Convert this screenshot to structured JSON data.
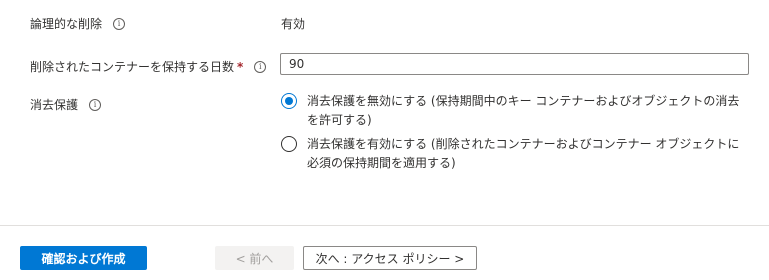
{
  "fields": {
    "soft_delete": {
      "label": "論理的な削除",
      "value": "有効"
    },
    "retention_days": {
      "label": "削除されたコンテナーを保持する日数",
      "required_mark": "*",
      "value": "90"
    },
    "purge_protection": {
      "label": "消去保護",
      "options": [
        {
          "label": "消去保護を無効にする (保持期間中のキー コンテナーおよびオブジェクトの消去を許可する)",
          "checked": true
        },
        {
          "label": "消去保護を有効にする (削除されたコンテナーおよびコンテナー オブジェクトに必須の保持期間を適用する)",
          "checked": false
        }
      ]
    }
  },
  "info_icon_glyph": "i",
  "footer": {
    "review_create_label": "確認および作成",
    "previous_label": "< 前へ",
    "next_label": "次へ : アクセス ポリシー >"
  },
  "colors": {
    "accent": "#0078d4",
    "required": "#a4262c"
  }
}
